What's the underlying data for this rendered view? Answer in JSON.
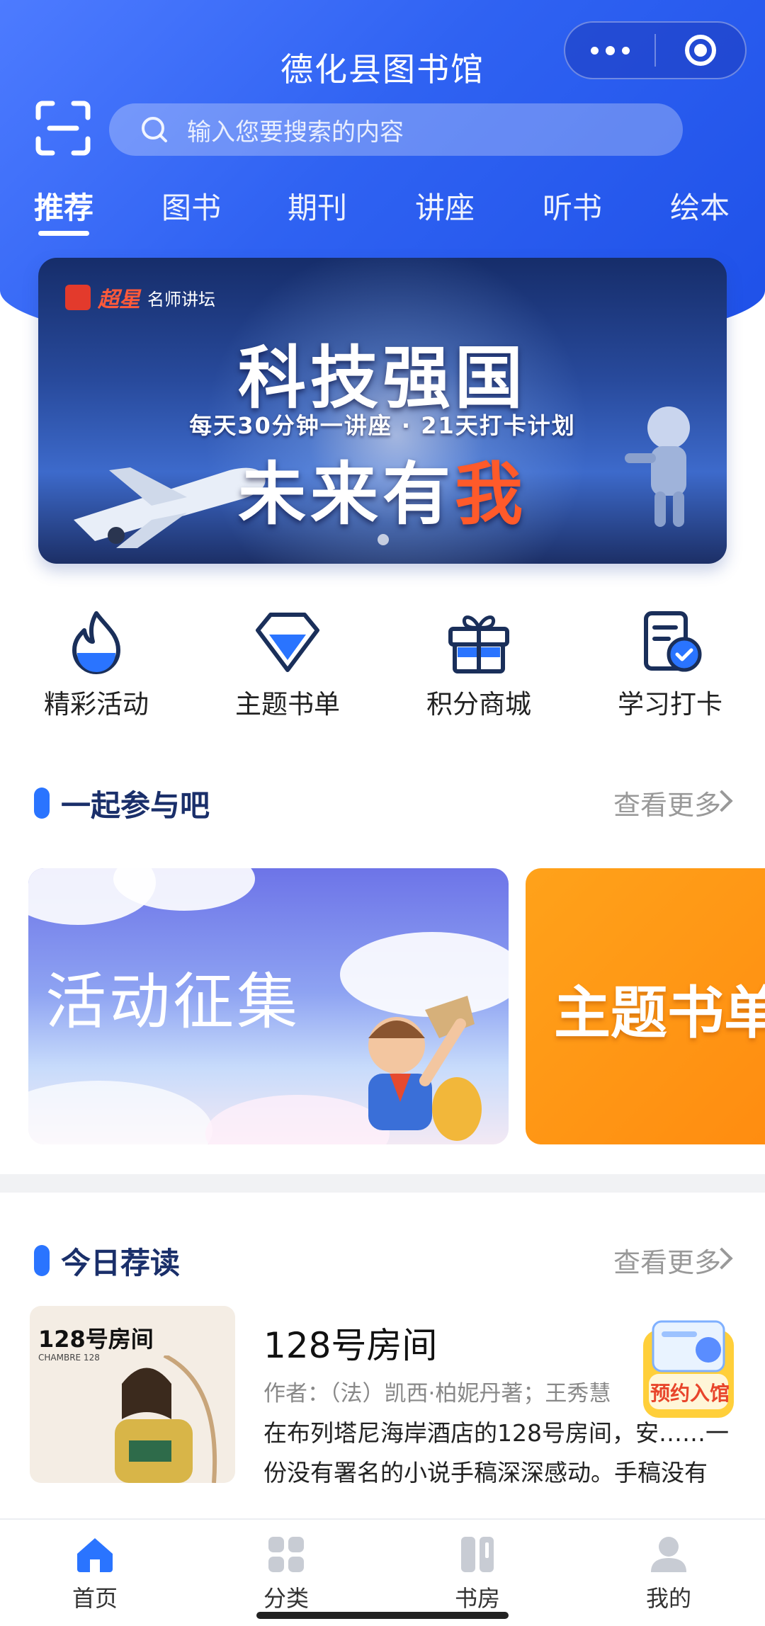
{
  "header": {
    "title": "德化县图书馆",
    "search_placeholder": "输入您要搜索的内容",
    "tabs": [
      "推荐",
      "图书",
      "期刊",
      "讲座",
      "听书",
      "绘本"
    ]
  },
  "banner": {
    "brand": "名师讲坛",
    "brand_logo_text": "超星",
    "line1": "科技强国",
    "line2": "每天30分钟一讲座 · 21天打卡计划",
    "line3_prefix": "未来有",
    "line3_highlight": "我"
  },
  "quick_actions": [
    {
      "label": "精彩活动",
      "icon": "flame-icon"
    },
    {
      "label": "主题书单",
      "icon": "diamond-icon"
    },
    {
      "label": "积分商城",
      "icon": "gift-icon"
    },
    {
      "label": "学习打卡",
      "icon": "checkin-icon"
    }
  ],
  "section_join": {
    "title": "一起参与吧",
    "more": "查看更多",
    "cards": [
      {
        "text": "活动征集"
      },
      {
        "text": "主题书单"
      }
    ]
  },
  "section_reading": {
    "title": "今日荐读",
    "more": "查看更多",
    "book": {
      "cover_title": "128号房间",
      "cover_sub": "CHAMBRE 128",
      "title": "128号房间",
      "author": "作者：（法）凯西·柏妮丹著；王秀慧",
      "description": "在布列塔尼海岸酒店的128号房间，安……一份没有署名的小说手稿深深感动。手稿没有"
    }
  },
  "floating_button": {
    "label": "预约入馆"
  },
  "bottom_nav": [
    {
      "label": "首页",
      "active": true
    },
    {
      "label": "分类",
      "active": false
    },
    {
      "label": "书房",
      "active": false
    },
    {
      "label": "我的",
      "active": false
    }
  ],
  "colors": {
    "primary": "#2f62f2",
    "accent": "#2a74ff",
    "orange": "#ff8c10",
    "highlight": "#ff5a2a"
  }
}
